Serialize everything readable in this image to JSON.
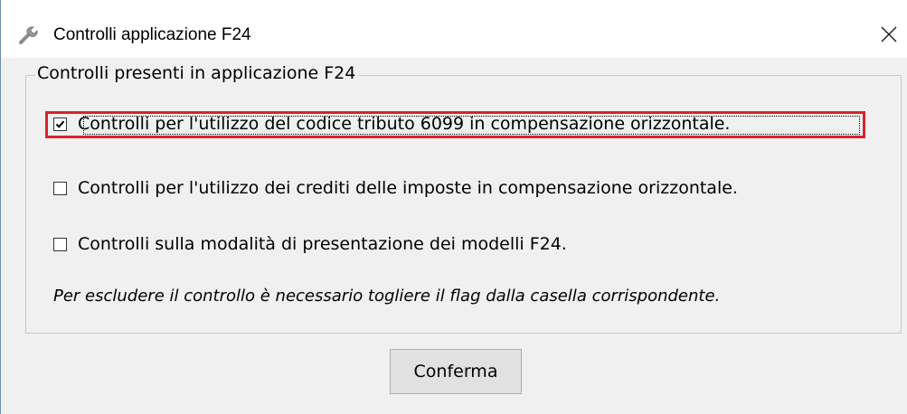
{
  "window": {
    "title": "Controlli applicazione F24",
    "close_symbol": "✕",
    "icon": "wrench-icon"
  },
  "group": {
    "legend": "Controlli presenti in applicazione F24",
    "checks": [
      {
        "label": "Controlli per l'utilizzo del codice tributo 6099 in compensazione orizzontale.",
        "checked": true
      },
      {
        "label": "Controlli per l'utilizzo dei crediti delle imposte in compensazione orizzontale.",
        "checked": false
      },
      {
        "label": "Controlli sulla modalità di presentazione dei modelli F24.",
        "checked": false
      }
    ],
    "note": "Per escludere il controllo è necessario togliere il flag dalla casella corrispondente."
  },
  "actions": {
    "confirm_label": "Conferma"
  },
  "colors": {
    "highlight_border": "#d6232c",
    "dialog_bg": "#f0f0f0",
    "titlebar_bg": "#ffffff"
  }
}
